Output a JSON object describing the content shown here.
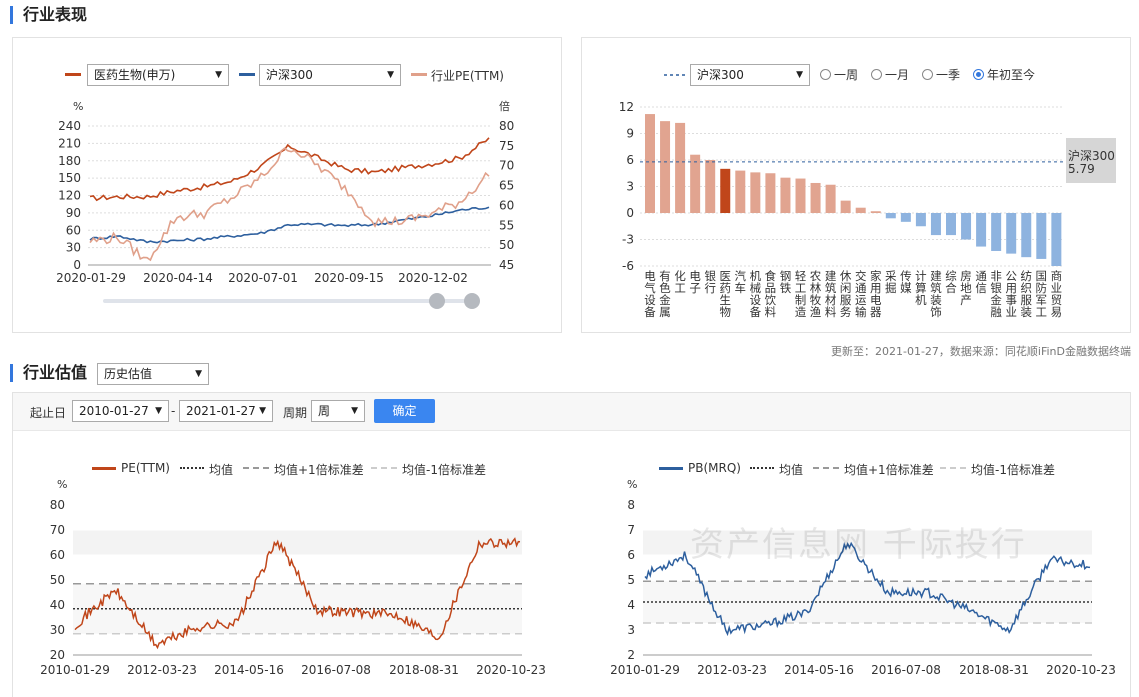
{
  "section1": {
    "title": "行业表现"
  },
  "perf": {
    "legend_industry": "医药生物(申万)",
    "legend_index": "沪深300",
    "legend_pe": "行业PE(TTM)",
    "left_unit": "%",
    "right_unit": "倍",
    "left_ticks": [
      "240",
      "210",
      "180",
      "150",
      "120",
      "90",
      "60",
      "30",
      "0"
    ],
    "right_ticks": [
      "80",
      "75",
      "70",
      "65",
      "60",
      "55",
      "50",
      "45"
    ],
    "x_ticks": [
      "2020-01-29",
      "2020-04-14",
      "2020-07-01",
      "2020-09-15",
      "2020-12-02"
    ]
  },
  "rank": {
    "index_select": "沪深300",
    "radios": [
      "一周",
      "一月",
      "一季",
      "年初至今"
    ],
    "selected_radio": "年初至今",
    "ref_label": "沪深300",
    "ref_value": "5.79",
    "y_ticks": [
      "12",
      "9",
      "6",
      "3",
      "0",
      "-3",
      "-6"
    ]
  },
  "rank_chart_data": {
    "type": "bar",
    "categories": [
      "电气设备",
      "有色金属",
      "化工",
      "电子",
      "银行",
      "医药生物",
      "汽车",
      "机械设备",
      "食品饮料",
      "钢铁",
      "轻工制造",
      "农林牧渔",
      "建筑材料",
      "休闲服务",
      "交通运输",
      "家用电器",
      "采掘",
      "传媒",
      "计算机",
      "建筑装饰",
      "综合",
      "房地产",
      "通信",
      "非银金融",
      "公用事业",
      "纺织服装",
      "国防军工",
      "商业贸易"
    ],
    "values": [
      11.2,
      10.4,
      10.2,
      6.6,
      6.0,
      5.0,
      4.8,
      4.6,
      4.5,
      4.0,
      3.9,
      3.4,
      3.2,
      1.4,
      0.6,
      0.2,
      -0.6,
      -1.0,
      -1.5,
      -2.5,
      -2.5,
      -3.0,
      -3.8,
      -4.3,
      -4.6,
      -5.0,
      -5.2,
      -6.0
    ],
    "highlight": "医药生物",
    "reference": 5.79,
    "ylim": [
      -6,
      12
    ]
  },
  "footer_note": "更新至：2021-01-27，数据来源：同花顺iFinD金融数据终端",
  "section2": {
    "title": "行业估值",
    "select": "历史估值"
  },
  "filters": {
    "start_label": "起止日",
    "start_date": "2010-01-27",
    "sep": "-",
    "end_date": "2021-01-27",
    "period_label": "周期",
    "period_value": "周",
    "confirm": "确定"
  },
  "pe": {
    "series": "PE(TTM)",
    "mean": "均值",
    "plus": "均值+1倍标准差",
    "minus": "均值-1倍标准差",
    "unit": "%",
    "y_ticks": [
      "80",
      "70",
      "60",
      "50",
      "40",
      "30",
      "20"
    ],
    "x_ticks": [
      "2010-01-29",
      "2012-03-23",
      "2014-05-16",
      "2016-07-08",
      "2018-08-31",
      "2020-10-23"
    ]
  },
  "pb": {
    "series": "PB(MRQ)",
    "mean": "均值",
    "plus": "均值+1倍标准差",
    "minus": "均值-1倍标准差",
    "unit": "%",
    "y_ticks": [
      "8",
      "7",
      "6",
      "5",
      "4",
      "3",
      "2"
    ],
    "x_ticks": [
      "2010-01-29",
      "2012-03-23",
      "2014-05-16",
      "2016-07-08",
      "2018-08-31",
      "2020-10-23"
    ],
    "watermark": "资产信息网 千际投行"
  },
  "chart_data": [
    {
      "type": "line",
      "title": "",
      "x": [
        "2020-01-29",
        "2020-02-20",
        "2020-03-15",
        "2020-04-14",
        "2020-05-10",
        "2020-06-05",
        "2020-07-01",
        "2020-07-25",
        "2020-08-20",
        "2020-09-15",
        "2020-10-10",
        "2020-11-05",
        "2020-12-02",
        "2020-12-28",
        "2021-01-27"
      ],
      "series": [
        {
          "name": "医药生物(申万)",
          "axis": "left",
          "values": [
            115,
            118,
            118,
            128,
            135,
            145,
            170,
            205,
            185,
            165,
            160,
            168,
            175,
            185,
            218
          ]
        },
        {
          "name": "沪深300",
          "axis": "left",
          "values": [
            45,
            50,
            40,
            42,
            45,
            50,
            55,
            70,
            70,
            68,
            70,
            78,
            85,
            95,
            100
          ]
        },
        {
          "name": "行业PE(TTM)",
          "axis": "right",
          "values": [
            51,
            52,
            46,
            57,
            58,
            62,
            67,
            75,
            70,
            64,
            56,
            56,
            58,
            61,
            68
          ]
        }
      ],
      "ylim": [
        0,
        240
      ],
      "y2lim": [
        45,
        80
      ]
    },
    {
      "type": "line",
      "title": "",
      "x": [
        "2010-01-29",
        "2011-01-28",
        "2012-03-23",
        "2013-04-26",
        "2014-05-16",
        "2015-06-12",
        "2016-07-08",
        "2017-08-04",
        "2018-08-31",
        "2019-09-27",
        "2020-10-23",
        "2021-01-22"
      ],
      "series": [
        {
          "name": "PE(TTM)",
          "values": [
            32,
            46,
            24,
            31,
            33,
            66,
            38,
            37,
            36,
            27,
            65,
            65
          ]
        },
        {
          "name": "均值",
          "values": [
            38.5,
            38.5,
            38.5,
            38.5,
            38.5,
            38.5,
            38.5,
            38.5,
            38.5,
            38.5,
            38.5,
            38.5
          ]
        },
        {
          "name": "均值+1倍标准差",
          "values": [
            48.5,
            48.5,
            48.5,
            48.5,
            48.5,
            48.5,
            48.5,
            48.5,
            48.5,
            48.5,
            48.5,
            48.5
          ]
        },
        {
          "name": "均值-1倍标准差",
          "values": [
            28.5,
            28.5,
            28.5,
            28.5,
            28.5,
            28.5,
            28.5,
            28.5,
            28.5,
            28.5,
            28.5,
            28.5
          ]
        }
      ],
      "ylim": [
        20,
        80
      ]
    },
    {
      "type": "line",
      "title": "",
      "x": [
        "2010-01-29",
        "2011-01-28",
        "2012-03-23",
        "2013-04-26",
        "2014-05-16",
        "2015-06-12",
        "2016-07-08",
        "2017-08-04",
        "2018-08-31",
        "2019-09-27",
        "2020-10-23",
        "2021-01-22"
      ],
      "series": [
        {
          "name": "PB(MRQ)",
          "values": [
            5.2,
            6.0,
            3.0,
            3.2,
            3.7,
            6.5,
            4.5,
            4.5,
            3.8,
            3.0,
            5.8,
            5.6
          ]
        },
        {
          "name": "均值",
          "values": [
            4.12,
            4.12,
            4.12,
            4.12,
            4.12,
            4.12,
            4.12,
            4.12,
            4.12,
            4.12,
            4.12,
            4.12
          ]
        },
        {
          "name": "均值+1倍标准差",
          "values": [
            4.95,
            4.95,
            4.95,
            4.95,
            4.95,
            4.95,
            4.95,
            4.95,
            4.95,
            4.95,
            4.95,
            4.95
          ]
        },
        {
          "name": "均值-1倍标准差",
          "values": [
            3.28,
            3.28,
            3.28,
            3.28,
            3.28,
            3.28,
            3.28,
            3.28,
            3.28,
            3.28,
            3.28,
            3.28
          ]
        }
      ],
      "ylim": [
        2,
        8
      ]
    }
  ],
  "colors": {
    "industry": "#c0461a",
    "index": "#2d5f9e",
    "pe_line": "#e0a08a",
    "bar_pos": "#e1a490",
    "bar_hi": "#c0461a",
    "bar_neg": "#8eb3df",
    "accent": "#3377dd"
  }
}
